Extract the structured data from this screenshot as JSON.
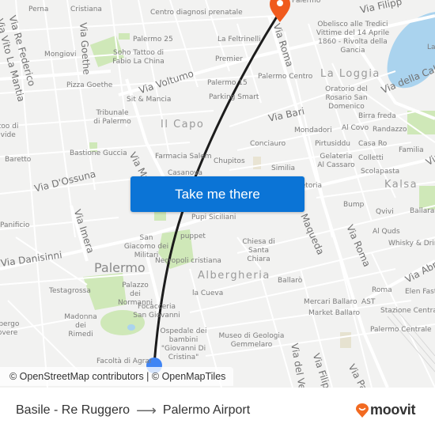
{
  "map": {
    "attribution": "© OpenStreetMap contributors | © OpenMapTiles",
    "cta_label": "Take me there",
    "origin_marker": "origin-dot",
    "destination_marker": "destination-pin",
    "colors": {
      "background": "#f2f2f1",
      "road": "#ffffff",
      "park": "#cfe8b8",
      "water": "#aad3ee",
      "route": "#1c1c1c",
      "destination_pin": "#f05a1d",
      "origin_dot": "#3f84f4",
      "cta": "#0b74d6"
    },
    "streets": [
      "Via Re Federico",
      "Via Vito La Mantia",
      "Via Goethe",
      "Via Voltumo",
      "Via Roma",
      "Via Filipp",
      "Via della Cala",
      "Via Bari",
      "Via D'Ossuna",
      "Via Ma",
      "Via Imera",
      "Via Danisinni",
      "Maqueda",
      "Via Roma",
      "Via Abra",
      "Via del Ve",
      "Via Filipp",
      "Via Pa",
      "Via"
    ],
    "districts": [
      "Il Capo",
      "La Loggia",
      "Kalsa",
      "Albergheria"
    ],
    "city": "Palermo",
    "pois": [
      "Perna",
      "Cristiana",
      "Centro diagnosi prenatale",
      "Palermo",
      "Palermo 25",
      "La Feltrinelli",
      "Obelisco alle Tredici Vittime del 14 Aprile 1860 - Rivolta della Gancia",
      "La",
      "Mongiovi",
      "Soho Tattoo di Fabio La China",
      "Premier",
      "Pizza Goethe",
      "Palermo 15",
      "Palermo Centro",
      "Sit & Mancia",
      "Parking Smart",
      "Oratorio del Rosario San Domenico",
      "Tribunale di Palermo",
      "Tattoo di Davide",
      "Birra freda",
      "Mondadori",
      "Al Covo",
      "Randazzo",
      "Bastione Guccia",
      "Farmacia Salem",
      "Conciauro",
      "Pirtusiddu",
      "Casa Ro",
      "Familia",
      "Baretto",
      "Chupitos",
      "Similia",
      "Gelateria Al Cassaro",
      "Colletti",
      "Scolapasta",
      "Casanova",
      "Pretoria",
      "Bump",
      "Qvivi",
      "Ballarak",
      "Panificio",
      "Pupi Siciliani",
      "Al Quds",
      "Whisky & Drink",
      "San Giacomo dei Militari",
      "puppet",
      "Chiesa di Santa Chiara",
      "Necropoli cristiana",
      "Testagrossa",
      "Palazzo dei Normanni",
      "la Cueva",
      "Ballarò",
      "Elen Fast",
      "Roma",
      "Mercari Ballaro",
      "AST",
      "Market Ballaro",
      "Stazione Centrale",
      "Focacceria San Giovanni",
      "Madonna dei Rimedi",
      "Albergo Povere",
      "Ospedale dei bambini \"Giovanni Di Cristina\"",
      "Museo di Geologia Gemmelaro",
      "Palermo Centrale",
      "Facoltà di Agrar"
    ]
  },
  "footer": {
    "origin": "Basile - Re Ruggero",
    "arrow": "⟶",
    "destination": "Palermo Airport",
    "brand": "moovit",
    "brand_color": "#f26a21"
  }
}
